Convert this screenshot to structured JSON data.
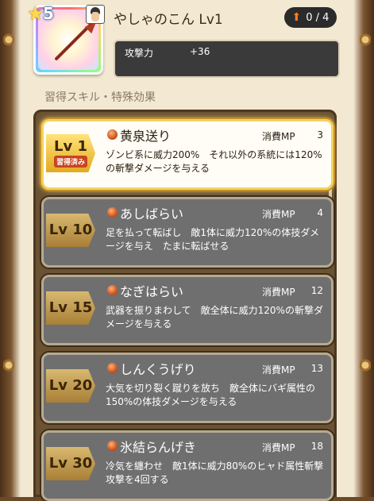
{
  "weapon": {
    "name": "やしゃのこん Lv1",
    "stars": "5",
    "slot": "0 / 4",
    "stats": [
      {
        "label": "攻撃力",
        "value": "+36"
      }
    ]
  },
  "section_title": "習得スキル・特殊効果",
  "skills": [
    {
      "level": "Lv 1",
      "learned": "習得済み",
      "name": "黄泉送り",
      "mp_label": "消費MP",
      "mp": "3",
      "desc": "ゾンビ系に威力200%　それ以外の系統には120%の斬撃ダメージを与える"
    },
    {
      "level": "Lv 10",
      "name": "あしばらい",
      "mp_label": "消費MP",
      "mp": "4",
      "desc": "足を払って転ばし　敵1体に威力120%の体技ダメージを与え　たまに転ばせる"
    },
    {
      "level": "Lv 15",
      "name": "なぎはらい",
      "mp_label": "消費MP",
      "mp": "12",
      "desc": "武器を振りまわして　敵全体に威力120%の斬撃ダメージを与える"
    },
    {
      "level": "Lv 20",
      "name": "しんくうげり",
      "mp_label": "消費MP",
      "mp": "13",
      "desc": "大気を切り裂く蹴りを放ち　敵全体にバギ属性の150%の体技ダメージを与える"
    },
    {
      "level": "Lv 30",
      "name": "氷結らんげき",
      "mp_label": "消費MP",
      "mp": "18",
      "desc": "冷気を纏わせ　敵1体に威力80%のヒャド属性斬撃攻撃を4回する"
    }
  ]
}
